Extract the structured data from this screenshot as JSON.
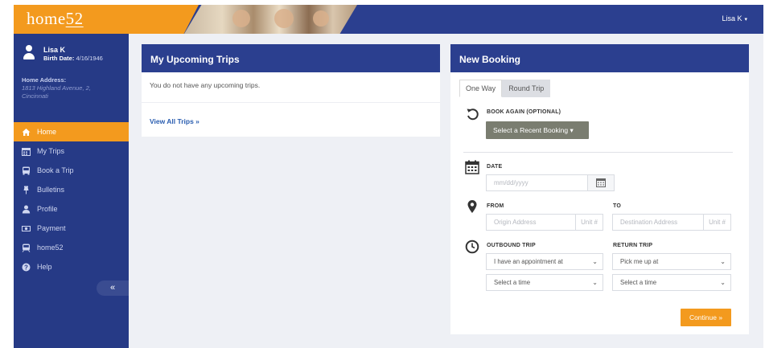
{
  "brand": {
    "name": "home",
    "number": "52"
  },
  "header": {
    "user_menu": "Lisa K"
  },
  "sidebar": {
    "user_name": "Lisa K",
    "birth_label": "Birth Date:",
    "birth_date": "4/16/1946",
    "address_label": "Home Address:",
    "address": "1813 Highland Avenue, 2, Cincinnati",
    "items": [
      {
        "label": "Home",
        "icon": "home-icon",
        "active": true
      },
      {
        "label": "My Trips",
        "icon": "calendar-icon"
      },
      {
        "label": "Book a Trip",
        "icon": "bus-icon"
      },
      {
        "label": "Bulletins",
        "icon": "pin-icon"
      },
      {
        "label": "Profile",
        "icon": "user-icon"
      },
      {
        "label": "Payment",
        "icon": "money-icon"
      },
      {
        "label": "home52",
        "icon": "train-icon"
      },
      {
        "label": "Help",
        "icon": "question-icon"
      }
    ],
    "collapse_label": "«"
  },
  "trips": {
    "title": "My Upcoming Trips",
    "empty_message": "You do not have any upcoming trips.",
    "view_all": "View All Trips »"
  },
  "booking": {
    "title": "New Booking",
    "tabs": [
      "One Way",
      "Round Trip"
    ],
    "book_again_label": "BOOK AGAIN (OPTIONAL)",
    "recent_booking_button": "Select a Recent Booking ▾",
    "date_label": "DATE",
    "date_placeholder": "mm/dd/yyyy",
    "from_label": "FROM",
    "to_label": "TO",
    "origin_placeholder": "Origin Address",
    "destination_placeholder": "Destination Address",
    "unit_placeholder": "Unit #",
    "outbound_label": "OUTBOUND TRIP",
    "return_label": "RETURN TRIP",
    "outbound_mode": "I have an appointment at",
    "return_mode": "Pick me up at",
    "outbound_time": "Select a time",
    "return_time": "Select a time",
    "continue_button": "Continue »"
  },
  "colors": {
    "accent": "#f39a1e",
    "primary": "#2b3f8f",
    "sidebar": "#263a86"
  }
}
